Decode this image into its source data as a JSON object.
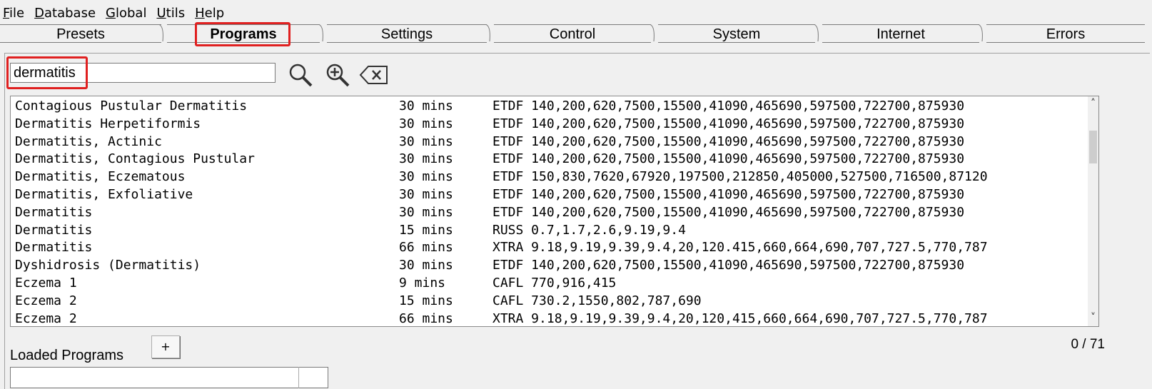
{
  "menu": [
    {
      "accel": "F",
      "rest": "ile"
    },
    {
      "accel": "D",
      "rest": "atabase"
    },
    {
      "accel": "G",
      "rest": "lobal"
    },
    {
      "accel": "U",
      "rest": "tils"
    },
    {
      "accel": "H",
      "rest": "elp"
    }
  ],
  "tabs": [
    "Presets",
    "Programs",
    "Settings",
    "Control",
    "System",
    "Internet",
    "Errors"
  ],
  "selected_tab": "Programs",
  "search": {
    "value": "dermatitis"
  },
  "icons": {
    "search": "magnifier-icon",
    "zoom": "zoom-in-icon",
    "clear": "backspace-clear-icon"
  },
  "results": [
    {
      "name": "Contagious Pustular Dermatitis",
      "duration": "30 mins",
      "freqs": "ETDF 140,200,620,7500,15500,41090,465690,597500,722700,875930"
    },
    {
      "name": "Dermatitis Herpetiformis",
      "duration": "30 mins",
      "freqs": "ETDF 140,200,620,7500,15500,41090,465690,597500,722700,875930"
    },
    {
      "name": "Dermatitis, Actinic",
      "duration": "30 mins",
      "freqs": "ETDF 140,200,620,7500,15500,41090,465690,597500,722700,875930"
    },
    {
      "name": "Dermatitis, Contagious Pustular",
      "duration": "30 mins",
      "freqs": "ETDF 140,200,620,7500,15500,41090,465690,597500,722700,875930"
    },
    {
      "name": "Dermatitis, Eczematous",
      "duration": "30 mins",
      "freqs": "ETDF 150,830,7620,67920,197500,212850,405000,527500,716500,87120"
    },
    {
      "name": "Dermatitis, Exfoliative",
      "duration": "30 mins",
      "freqs": "ETDF 140,200,620,7500,15500,41090,465690,597500,722700,875930"
    },
    {
      "name": "Dermatitis",
      "duration": "30 mins",
      "freqs": "ETDF 140,200,620,7500,15500,41090,465690,597500,722700,875930"
    },
    {
      "name": "Dermatitis",
      "duration": "15 mins",
      "freqs": "RUSS 0.7,1.7,2.6,9.19,9.4"
    },
    {
      "name": "Dermatitis",
      "duration": "66 mins",
      "freqs": "XTRA 9.18,9.19,9.39,9.4,20,120.415,660,664,690,707,727.5,770,787"
    },
    {
      "name": "Dyshidrosis (Dermatitis)",
      "duration": "30 mins",
      "freqs": "ETDF 140,200,620,7500,15500,41090,465690,597500,722700,875930"
    },
    {
      "name": "Eczema 1",
      "duration": "9 mins",
      "freqs": "CAFL 770,916,415"
    },
    {
      "name": "Eczema 2",
      "duration": "15 mins",
      "freqs": "CAFL 730.2,1550,802,787,690"
    },
    {
      "name": "Eczema 2",
      "duration": "66 mins",
      "freqs": "XTRA 9.18,9.19,9.39,9.4,20,120,415,660,664,690,707,727.5,770,787"
    }
  ],
  "loaded": {
    "label": "Loaded Programs",
    "add_label": "+",
    "counter": "0 / 71"
  },
  "colors": {
    "highlight": "#e02020",
    "panel": "#f0f0f0",
    "list_bg": "#ffffff"
  }
}
